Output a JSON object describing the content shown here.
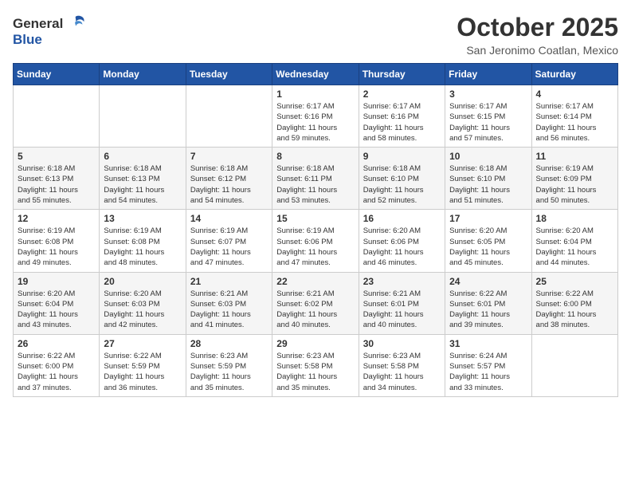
{
  "header": {
    "logo_general": "General",
    "logo_blue": "Blue",
    "title": "October 2025",
    "location": "San Jeronimo Coatlan, Mexico"
  },
  "days_of_week": [
    "Sunday",
    "Monday",
    "Tuesday",
    "Wednesday",
    "Thursday",
    "Friday",
    "Saturday"
  ],
  "weeks": [
    [
      {
        "day": "",
        "info": ""
      },
      {
        "day": "",
        "info": ""
      },
      {
        "day": "",
        "info": ""
      },
      {
        "day": "1",
        "info": "Sunrise: 6:17 AM\nSunset: 6:16 PM\nDaylight: 11 hours\nand 59 minutes."
      },
      {
        "day": "2",
        "info": "Sunrise: 6:17 AM\nSunset: 6:16 PM\nDaylight: 11 hours\nand 58 minutes."
      },
      {
        "day": "3",
        "info": "Sunrise: 6:17 AM\nSunset: 6:15 PM\nDaylight: 11 hours\nand 57 minutes."
      },
      {
        "day": "4",
        "info": "Sunrise: 6:17 AM\nSunset: 6:14 PM\nDaylight: 11 hours\nand 56 minutes."
      }
    ],
    [
      {
        "day": "5",
        "info": "Sunrise: 6:18 AM\nSunset: 6:13 PM\nDaylight: 11 hours\nand 55 minutes."
      },
      {
        "day": "6",
        "info": "Sunrise: 6:18 AM\nSunset: 6:13 PM\nDaylight: 11 hours\nand 54 minutes."
      },
      {
        "day": "7",
        "info": "Sunrise: 6:18 AM\nSunset: 6:12 PM\nDaylight: 11 hours\nand 54 minutes."
      },
      {
        "day": "8",
        "info": "Sunrise: 6:18 AM\nSunset: 6:11 PM\nDaylight: 11 hours\nand 53 minutes."
      },
      {
        "day": "9",
        "info": "Sunrise: 6:18 AM\nSunset: 6:10 PM\nDaylight: 11 hours\nand 52 minutes."
      },
      {
        "day": "10",
        "info": "Sunrise: 6:18 AM\nSunset: 6:10 PM\nDaylight: 11 hours\nand 51 minutes."
      },
      {
        "day": "11",
        "info": "Sunrise: 6:19 AM\nSunset: 6:09 PM\nDaylight: 11 hours\nand 50 minutes."
      }
    ],
    [
      {
        "day": "12",
        "info": "Sunrise: 6:19 AM\nSunset: 6:08 PM\nDaylight: 11 hours\nand 49 minutes."
      },
      {
        "day": "13",
        "info": "Sunrise: 6:19 AM\nSunset: 6:08 PM\nDaylight: 11 hours\nand 48 minutes."
      },
      {
        "day": "14",
        "info": "Sunrise: 6:19 AM\nSunset: 6:07 PM\nDaylight: 11 hours\nand 47 minutes."
      },
      {
        "day": "15",
        "info": "Sunrise: 6:19 AM\nSunset: 6:06 PM\nDaylight: 11 hours\nand 47 minutes."
      },
      {
        "day": "16",
        "info": "Sunrise: 6:20 AM\nSunset: 6:06 PM\nDaylight: 11 hours\nand 46 minutes."
      },
      {
        "day": "17",
        "info": "Sunrise: 6:20 AM\nSunset: 6:05 PM\nDaylight: 11 hours\nand 45 minutes."
      },
      {
        "day": "18",
        "info": "Sunrise: 6:20 AM\nSunset: 6:04 PM\nDaylight: 11 hours\nand 44 minutes."
      }
    ],
    [
      {
        "day": "19",
        "info": "Sunrise: 6:20 AM\nSunset: 6:04 PM\nDaylight: 11 hours\nand 43 minutes."
      },
      {
        "day": "20",
        "info": "Sunrise: 6:20 AM\nSunset: 6:03 PM\nDaylight: 11 hours\nand 42 minutes."
      },
      {
        "day": "21",
        "info": "Sunrise: 6:21 AM\nSunset: 6:03 PM\nDaylight: 11 hours\nand 41 minutes."
      },
      {
        "day": "22",
        "info": "Sunrise: 6:21 AM\nSunset: 6:02 PM\nDaylight: 11 hours\nand 40 minutes."
      },
      {
        "day": "23",
        "info": "Sunrise: 6:21 AM\nSunset: 6:01 PM\nDaylight: 11 hours\nand 40 minutes."
      },
      {
        "day": "24",
        "info": "Sunrise: 6:22 AM\nSunset: 6:01 PM\nDaylight: 11 hours\nand 39 minutes."
      },
      {
        "day": "25",
        "info": "Sunrise: 6:22 AM\nSunset: 6:00 PM\nDaylight: 11 hours\nand 38 minutes."
      }
    ],
    [
      {
        "day": "26",
        "info": "Sunrise: 6:22 AM\nSunset: 6:00 PM\nDaylight: 11 hours\nand 37 minutes."
      },
      {
        "day": "27",
        "info": "Sunrise: 6:22 AM\nSunset: 5:59 PM\nDaylight: 11 hours\nand 36 minutes."
      },
      {
        "day": "28",
        "info": "Sunrise: 6:23 AM\nSunset: 5:59 PM\nDaylight: 11 hours\nand 35 minutes."
      },
      {
        "day": "29",
        "info": "Sunrise: 6:23 AM\nSunset: 5:58 PM\nDaylight: 11 hours\nand 35 minutes."
      },
      {
        "day": "30",
        "info": "Sunrise: 6:23 AM\nSunset: 5:58 PM\nDaylight: 11 hours\nand 34 minutes."
      },
      {
        "day": "31",
        "info": "Sunrise: 6:24 AM\nSunset: 5:57 PM\nDaylight: 11 hours\nand 33 minutes."
      },
      {
        "day": "",
        "info": ""
      }
    ]
  ]
}
